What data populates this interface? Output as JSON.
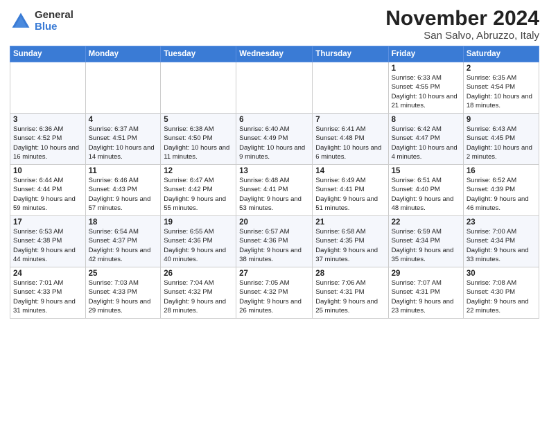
{
  "logo": {
    "general": "General",
    "blue": "Blue"
  },
  "title": "November 2024",
  "location": "San Salvo, Abruzzo, Italy",
  "headers": [
    "Sunday",
    "Monday",
    "Tuesday",
    "Wednesday",
    "Thursday",
    "Friday",
    "Saturday"
  ],
  "rows": [
    [
      {
        "day": "",
        "sunrise": "",
        "sunset": "",
        "daylight": ""
      },
      {
        "day": "",
        "sunrise": "",
        "sunset": "",
        "daylight": ""
      },
      {
        "day": "",
        "sunrise": "",
        "sunset": "",
        "daylight": ""
      },
      {
        "day": "",
        "sunrise": "",
        "sunset": "",
        "daylight": ""
      },
      {
        "day": "",
        "sunrise": "",
        "sunset": "",
        "daylight": ""
      },
      {
        "day": "1",
        "sunrise": "Sunrise: 6:33 AM",
        "sunset": "Sunset: 4:55 PM",
        "daylight": "Daylight: 10 hours and 21 minutes."
      },
      {
        "day": "2",
        "sunrise": "Sunrise: 6:35 AM",
        "sunset": "Sunset: 4:54 PM",
        "daylight": "Daylight: 10 hours and 18 minutes."
      }
    ],
    [
      {
        "day": "3",
        "sunrise": "Sunrise: 6:36 AM",
        "sunset": "Sunset: 4:52 PM",
        "daylight": "Daylight: 10 hours and 16 minutes."
      },
      {
        "day": "4",
        "sunrise": "Sunrise: 6:37 AM",
        "sunset": "Sunset: 4:51 PM",
        "daylight": "Daylight: 10 hours and 14 minutes."
      },
      {
        "day": "5",
        "sunrise": "Sunrise: 6:38 AM",
        "sunset": "Sunset: 4:50 PM",
        "daylight": "Daylight: 10 hours and 11 minutes."
      },
      {
        "day": "6",
        "sunrise": "Sunrise: 6:40 AM",
        "sunset": "Sunset: 4:49 PM",
        "daylight": "Daylight: 10 hours and 9 minutes."
      },
      {
        "day": "7",
        "sunrise": "Sunrise: 6:41 AM",
        "sunset": "Sunset: 4:48 PM",
        "daylight": "Daylight: 10 hours and 6 minutes."
      },
      {
        "day": "8",
        "sunrise": "Sunrise: 6:42 AM",
        "sunset": "Sunset: 4:47 PM",
        "daylight": "Daylight: 10 hours and 4 minutes."
      },
      {
        "day": "9",
        "sunrise": "Sunrise: 6:43 AM",
        "sunset": "Sunset: 4:45 PM",
        "daylight": "Daylight: 10 hours and 2 minutes."
      }
    ],
    [
      {
        "day": "10",
        "sunrise": "Sunrise: 6:44 AM",
        "sunset": "Sunset: 4:44 PM",
        "daylight": "Daylight: 9 hours and 59 minutes."
      },
      {
        "day": "11",
        "sunrise": "Sunrise: 6:46 AM",
        "sunset": "Sunset: 4:43 PM",
        "daylight": "Daylight: 9 hours and 57 minutes."
      },
      {
        "day": "12",
        "sunrise": "Sunrise: 6:47 AM",
        "sunset": "Sunset: 4:42 PM",
        "daylight": "Daylight: 9 hours and 55 minutes."
      },
      {
        "day": "13",
        "sunrise": "Sunrise: 6:48 AM",
        "sunset": "Sunset: 4:41 PM",
        "daylight": "Daylight: 9 hours and 53 minutes."
      },
      {
        "day": "14",
        "sunrise": "Sunrise: 6:49 AM",
        "sunset": "Sunset: 4:41 PM",
        "daylight": "Daylight: 9 hours and 51 minutes."
      },
      {
        "day": "15",
        "sunrise": "Sunrise: 6:51 AM",
        "sunset": "Sunset: 4:40 PM",
        "daylight": "Daylight: 9 hours and 48 minutes."
      },
      {
        "day": "16",
        "sunrise": "Sunrise: 6:52 AM",
        "sunset": "Sunset: 4:39 PM",
        "daylight": "Daylight: 9 hours and 46 minutes."
      }
    ],
    [
      {
        "day": "17",
        "sunrise": "Sunrise: 6:53 AM",
        "sunset": "Sunset: 4:38 PM",
        "daylight": "Daylight: 9 hours and 44 minutes."
      },
      {
        "day": "18",
        "sunrise": "Sunrise: 6:54 AM",
        "sunset": "Sunset: 4:37 PM",
        "daylight": "Daylight: 9 hours and 42 minutes."
      },
      {
        "day": "19",
        "sunrise": "Sunrise: 6:55 AM",
        "sunset": "Sunset: 4:36 PM",
        "daylight": "Daylight: 9 hours and 40 minutes."
      },
      {
        "day": "20",
        "sunrise": "Sunrise: 6:57 AM",
        "sunset": "Sunset: 4:36 PM",
        "daylight": "Daylight: 9 hours and 38 minutes."
      },
      {
        "day": "21",
        "sunrise": "Sunrise: 6:58 AM",
        "sunset": "Sunset: 4:35 PM",
        "daylight": "Daylight: 9 hours and 37 minutes."
      },
      {
        "day": "22",
        "sunrise": "Sunrise: 6:59 AM",
        "sunset": "Sunset: 4:34 PM",
        "daylight": "Daylight: 9 hours and 35 minutes."
      },
      {
        "day": "23",
        "sunrise": "Sunrise: 7:00 AM",
        "sunset": "Sunset: 4:34 PM",
        "daylight": "Daylight: 9 hours and 33 minutes."
      }
    ],
    [
      {
        "day": "24",
        "sunrise": "Sunrise: 7:01 AM",
        "sunset": "Sunset: 4:33 PM",
        "daylight": "Daylight: 9 hours and 31 minutes."
      },
      {
        "day": "25",
        "sunrise": "Sunrise: 7:03 AM",
        "sunset": "Sunset: 4:33 PM",
        "daylight": "Daylight: 9 hours and 29 minutes."
      },
      {
        "day": "26",
        "sunrise": "Sunrise: 7:04 AM",
        "sunset": "Sunset: 4:32 PM",
        "daylight": "Daylight: 9 hours and 28 minutes."
      },
      {
        "day": "27",
        "sunrise": "Sunrise: 7:05 AM",
        "sunset": "Sunset: 4:32 PM",
        "daylight": "Daylight: 9 hours and 26 minutes."
      },
      {
        "day": "28",
        "sunrise": "Sunrise: 7:06 AM",
        "sunset": "Sunset: 4:31 PM",
        "daylight": "Daylight: 9 hours and 25 minutes."
      },
      {
        "day": "29",
        "sunrise": "Sunrise: 7:07 AM",
        "sunset": "Sunset: 4:31 PM",
        "daylight": "Daylight: 9 hours and 23 minutes."
      },
      {
        "day": "30",
        "sunrise": "Sunrise: 7:08 AM",
        "sunset": "Sunset: 4:30 PM",
        "daylight": "Daylight: 9 hours and 22 minutes."
      }
    ]
  ]
}
